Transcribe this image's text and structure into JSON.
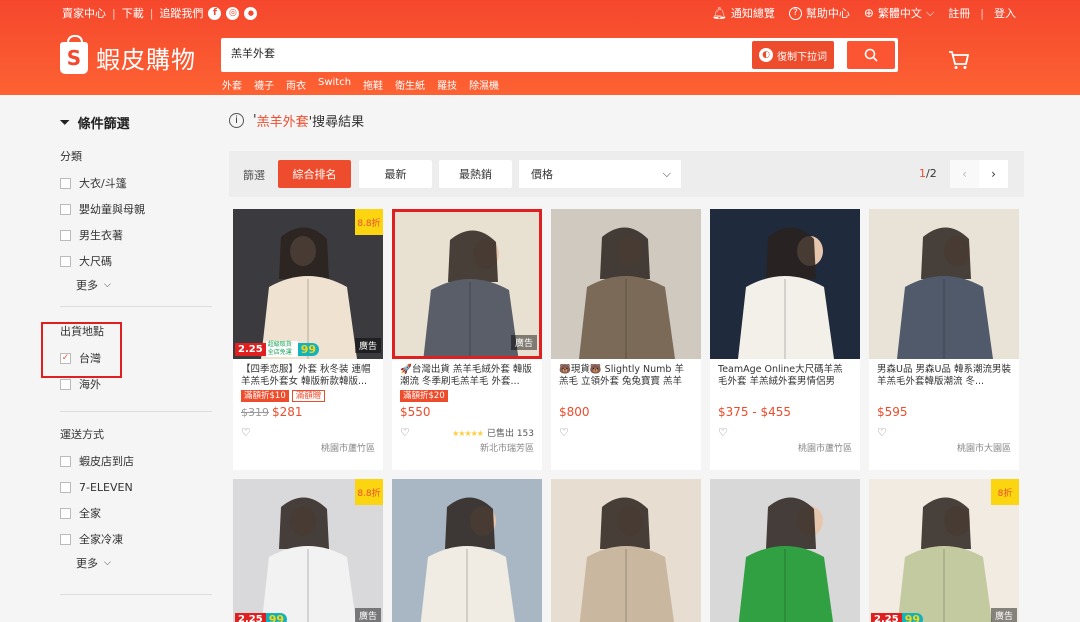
{
  "topbar": {
    "seller_center": "賣家中心",
    "download": "下載",
    "follow": "追蹤我們",
    "notifications": "通知總覽",
    "help": "幫助中心",
    "language": "繁體中文",
    "register": "註冊",
    "login": "登入"
  },
  "logo": {
    "name": "蝦皮購物",
    "letter": "S"
  },
  "search": {
    "value": "羔羊外套",
    "dropdown_label": "復制下拉词",
    "hotwords": [
      "外套",
      "襪子",
      "雨衣",
      "Switch",
      "拖鞋",
      "衛生紙",
      "羅技",
      "除濕機"
    ]
  },
  "sidebar": {
    "title": "條件篩選",
    "category": {
      "label": "分類",
      "items": [
        "大衣/斗篷",
        "嬰幼童與母親",
        "男生衣著",
        "大尺碼"
      ],
      "more": "更多"
    },
    "location": {
      "label": "出貨地點",
      "items": [
        "台灣",
        "海外"
      ],
      "checked": [
        true,
        false
      ]
    },
    "shipping": {
      "label": "運送方式",
      "items": [
        "蝦皮店到店",
        "7-ELEVEN",
        "全家",
        "全家冷凍"
      ],
      "more": "更多"
    }
  },
  "results": {
    "prefix": "'",
    "keyword": "羔羊外套",
    "suffix": "'搜尋結果"
  },
  "sortbar": {
    "label": "篩選",
    "options": [
      "綜合排名",
      "最新",
      "最熱銷"
    ],
    "active": 0,
    "price_label": "價格",
    "page_current": "1",
    "page_total": "/2"
  },
  "products": [
    {
      "title": "【四季恋服】外套 秋冬装 連帽羊羔毛外套女 韓版新款韓版...",
      "discount_badge": "8.8折",
      "ad": "廣告",
      "promo_225": "2.25",
      "promo_99": "99",
      "promo_small": "超級取貨 全店免運",
      "tags": [
        "滿額折$10",
        "滿額贈"
      ],
      "price_orig": "$319",
      "price": "$281",
      "location": "桃園市蘆竹區",
      "img_colors": [
        "#3b3a3f",
        "#efe2d0"
      ]
    },
    {
      "title": "🚀台灣出貨 羔羊毛絨外套 韓版潮流 冬季刷毛羔羊毛 外套...",
      "ad": "廣告",
      "tags": [
        "滿額折$20"
      ],
      "price": "$550",
      "stars": "★★★★★",
      "sold": "已售出 153",
      "location": "新北市瑞芳區",
      "img_colors": [
        "#e8e1d2",
        "#5a5e68"
      ]
    },
    {
      "title": "🐻現貨🐻 Slightly Numb 羊羔毛 立領外套 兔兔寶寶 羔羊外...",
      "price": "$800",
      "location": "",
      "img_colors": [
        "#cfc9c0",
        "#7b6a58"
      ]
    },
    {
      "title": "TeamAge Online大尺碼羊羔毛外套 羊羔絨外套男情侶男款...",
      "price": "$375 - $455",
      "location": "桃園市蘆竹區",
      "img_colors": [
        "#1f2a3c",
        "#f3f0ea"
      ]
    },
    {
      "title": "男森U品 男森U品 韓系潮流男裝羊羔毛外套韓版潮流 冬...",
      "price": "$595",
      "location": "桃園市大園區",
      "img_colors": [
        "#e9e3d7",
        "#515a6b"
      ]
    }
  ],
  "row2": [
    {
      "discount_badge": "8.8折",
      "ad": "廣告",
      "promo_225": "2.25",
      "promo_99": "99",
      "img_colors": [
        "#d9d9dc",
        "#f2f2f2"
      ]
    },
    {
      "img_colors": [
        "#a8b7c3",
        "#f0ebe3"
      ]
    },
    {
      "img_colors": [
        "#e7ddd1",
        "#c9b79f"
      ]
    },
    {
      "img_colors": [
        "#d8d8d8",
        "#31a043"
      ]
    },
    {
      "discount_badge": "8折",
      "ad": "廣告",
      "promo_225": "2.25",
      "promo_99": "99",
      "img_colors": [
        "#f2ebe1",
        "#c4caa0"
      ]
    }
  ]
}
